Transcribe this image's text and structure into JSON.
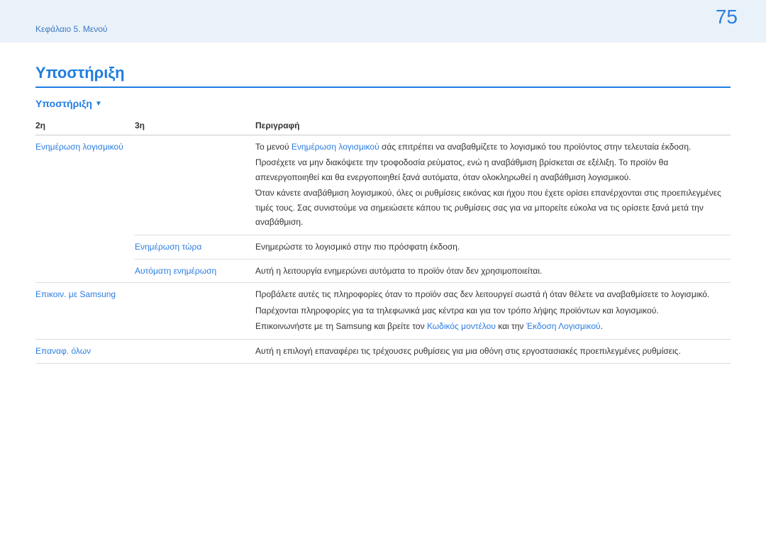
{
  "breadcrumb": "Κεφάλαιο 5. Μενού",
  "page_number": "75",
  "title": "Υποστήριξη",
  "section": "Υποστήριξη",
  "thead": {
    "c1": "2η",
    "c2": "3η",
    "c3": "Περιγραφή"
  },
  "rows": [
    {
      "c1": "Ενημέρωση λογισμικού",
      "c2": "",
      "desc_prefix": "Το μενού ",
      "desc_link": "Ενημέρωση λογισμικού",
      "desc_suffix": " σάς επιτρέπει να αναβαθμίζετε το λογισμικό του προϊόντος στην τελευταία έκδοση.",
      "p2": "Προσέχετε να μην διακόψετε την τροφοδοσία ρεύματος, ενώ η αναβάθμιση βρίσκεται σε εξέλιξη. Το προϊόν θα απενεργοποιηθεί και θα ενεργοποιηθεί ξανά αυτόματα, όταν ολοκληρωθεί η αναβάθμιση λογισμικού.",
      "p3": "Όταν κάνετε αναβάθμιση λογισμικού, όλες οι ρυθμίσεις εικόνας και ήχου που έχετε ορίσει επανέρχονται στις προεπιλεγμένες τιμές τους. Σας συνιστούμε να σημειώσετε κάπου τις ρυθμίσεις σας για να μπορείτε εύκολα να τις ορίσετε ξανά μετά την αναβάθμιση."
    },
    {
      "c1": "",
      "c2": "Ενημέρωση τώρα",
      "desc": "Ενημερώστε το λογισμικό στην πιο πρόσφατη έκδοση."
    },
    {
      "c1": "",
      "c2": "Αυτόματη ενημέρωση",
      "desc": "Αυτή η λειτουργία ενημερώνει αυτόματα το προϊόν όταν δεν χρησιμοποιείται."
    },
    {
      "c1": "Επικοιν. με Samsung",
      "c2": "",
      "p1": "Προβάλετε αυτές τις πληροφορίες όταν το προϊόν σας δεν λειτουργεί σωστά ή όταν θέλετε να αναβαθμίσετε το λογισμικό.",
      "p2": "Παρέχονται πληροφορίες για τα τηλεφωνικά μας κέντρα και για τον τρόπο λήψης προϊόντων και λογισμικού.",
      "p3_prefix": "Επικοινωνήστε με τη Samsung και βρείτε τον ",
      "p3_link1": "Κωδικός μοντέλου",
      "p3_mid": " και την ",
      "p3_link2": "Έκδοση Λογισμικού",
      "p3_suffix": "."
    },
    {
      "c1": "Επαναφ. όλων",
      "c2": "",
      "desc": "Αυτή η επιλογή επαναφέρει τις τρέχουσες ρυθμίσεις για μια οθόνη στις εργοστασιακές προεπιλεγμένες ρυθμίσεις."
    }
  ]
}
